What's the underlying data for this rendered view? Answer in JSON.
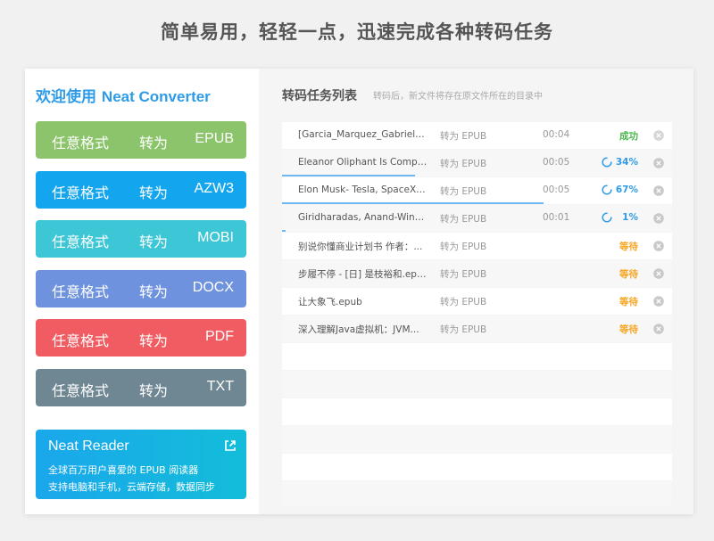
{
  "headline": "简单易用，轻轻一点，迅速完成各种转码任务",
  "sidebar": {
    "welcome_prefix": "欢迎使用 ",
    "welcome_brand": "Neat Converter",
    "buttons": [
      {
        "from": "任意格式",
        "to_word": "转为",
        "format": "EPUB",
        "color": "#8bc46a"
      },
      {
        "from": "任意格式",
        "to_word": "转为",
        "format": "AZW3",
        "color": "#13a6ee"
      },
      {
        "from": "任意格式",
        "to_word": "转为",
        "format": "MOBI",
        "color": "#3cc6d6"
      },
      {
        "from": "任意格式",
        "to_word": "转为",
        "format": "DOCX",
        "color": "#6e92dd"
      },
      {
        "from": "任意格式",
        "to_word": "转为",
        "format": "PDF",
        "color": "#f05c62"
      },
      {
        "from": "任意格式",
        "to_word": "转为",
        "format": "TXT",
        "color": "#6f8792"
      }
    ],
    "reader": {
      "title": "Neat Reader",
      "line1": "全球百万用户喜爱的 EPUB 阅读器",
      "line2": "支持电脑和手机，云端存储，数据同步",
      "icon": "external-link-icon"
    }
  },
  "main": {
    "title": "转码任务列表",
    "hint": "转码后，新文件将存在原文件所在的目录中",
    "tasks": [
      {
        "name": "[Garcia_Marquez_Gabriel]_...",
        "format": "转为 EPUB",
        "time": "00:04",
        "status": "成功",
        "kind": "ok",
        "progress": 1.0
      },
      {
        "name": "Eleanor Oliphant Is Comple...",
        "format": "转为 EPUB",
        "time": "00:05",
        "status": "34%",
        "kind": "pct",
        "progress": 0.34
      },
      {
        "name": "Elon Musk- Tesla, SpaceX, ...",
        "format": "转为 EPUB",
        "time": "00:05",
        "status": "67%",
        "kind": "pct",
        "progress": 0.67
      },
      {
        "name": "Giridharadas, Anand-Winn...",
        "format": "转为 EPUB",
        "time": "00:01",
        "status": "1%",
        "kind": "pct",
        "progress": 0.01
      },
      {
        "name": "别说你懂商业计划书 作者：...",
        "format": "转为 EPUB",
        "time": "",
        "status": "等待",
        "kind": "wait",
        "progress": 0
      },
      {
        "name": "步履不停 - [日] 是枝裕和.epub",
        "format": "转为 EPUB",
        "time": "",
        "status": "等待",
        "kind": "wait",
        "progress": 0
      },
      {
        "name": "让大象飞.epub",
        "format": "转为 EPUB",
        "time": "",
        "status": "等待",
        "kind": "wait",
        "progress": 0
      },
      {
        "name": "深入理解Java虚拟机：JVM...",
        "format": "转为 EPUB",
        "time": "",
        "status": "等待",
        "kind": "wait",
        "progress": 0
      }
    ]
  }
}
